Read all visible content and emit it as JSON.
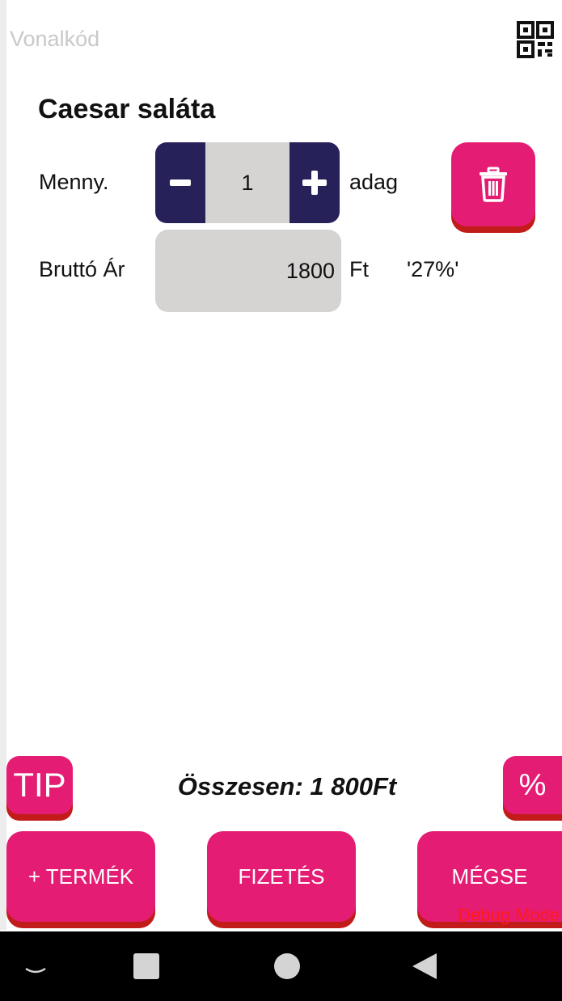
{
  "barcode": {
    "placeholder": "Vonalkód",
    "value": ""
  },
  "qr_button": {
    "icon": "qr-code-icon"
  },
  "product": {
    "title": "Caesar saláta",
    "quantity_label": "Menny.",
    "quantity": "1",
    "unit": "adag",
    "price_label": "Bruttó Ár",
    "price": "1800",
    "currency": "Ft",
    "vat": "'27%'"
  },
  "footer": {
    "tip_label": "TIP",
    "total": "Összesen: 1 800Ft",
    "percent_label": "%",
    "add_label": "+ TERMÉK",
    "pay_label": "FIZETÉS",
    "cancel_label": "MÉGSE",
    "debug": "Debug Mode"
  },
  "colors": {
    "accent": "#e51c73",
    "accent_shadow": "#c11c1a",
    "stepper": "#27215a",
    "field": "#d6d3d3",
    "debug_text": "#ff1a1a"
  },
  "icons": [
    "qr-code-icon",
    "minus-icon",
    "plus-icon",
    "trash-icon",
    "nav-hide-icon",
    "nav-recents-icon",
    "nav-home-icon",
    "nav-back-icon"
  ]
}
